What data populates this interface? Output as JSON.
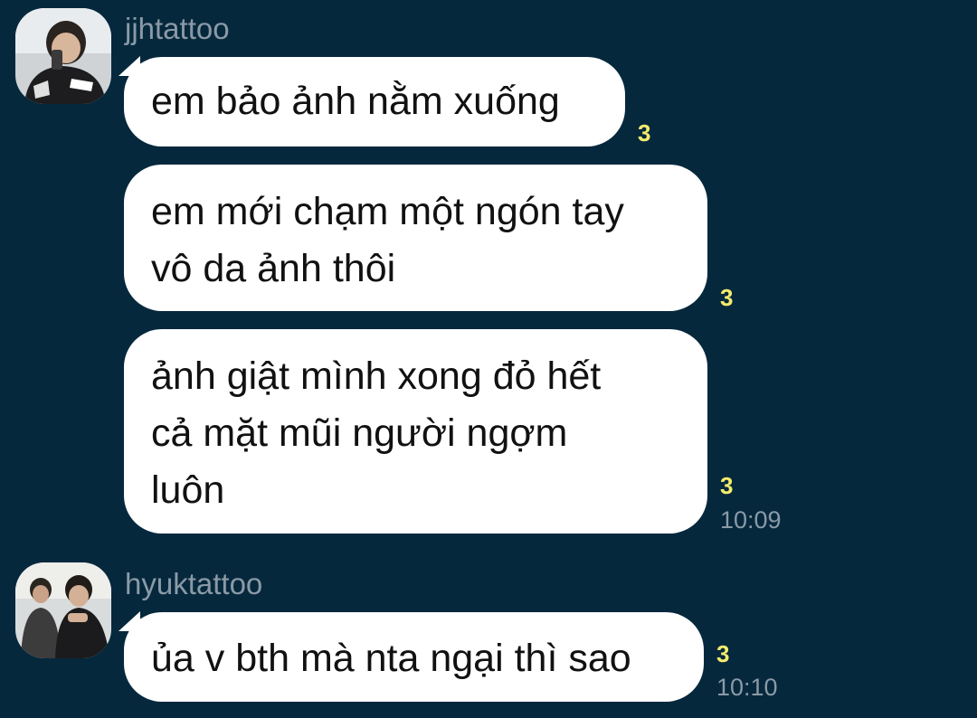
{
  "messages": [
    {
      "sender": "jjhtattoo",
      "bubbles": [
        {
          "lines": [
            "em bảo ảnh nằm xuống"
          ],
          "unread": "3"
        },
        {
          "lines": [
            "em mới chạm một ngón tay",
            "vô da ảnh thôi"
          ],
          "unread": "3"
        },
        {
          "lines": [
            "ảnh giật mình xong đỏ hết",
            "cả mặt mũi người ngợm",
            "luôn"
          ],
          "unread": "3",
          "time": "10:09"
        }
      ]
    },
    {
      "sender": "hyuktattoo",
      "bubbles": [
        {
          "lines": [
            "ủa v bth mà nta ngại thì sao"
          ],
          "unread": "3",
          "time": "10:10"
        }
      ]
    }
  ],
  "colors": {
    "background": "#06283d",
    "bubble": "#ffffff",
    "unread": "#f4ec6b",
    "meta": "#8a9aa6"
  },
  "icons": {
    "avatar_1": "avatar-photo-man-holding-phone",
    "avatar_2": "avatar-photo-two-men-sitting"
  }
}
